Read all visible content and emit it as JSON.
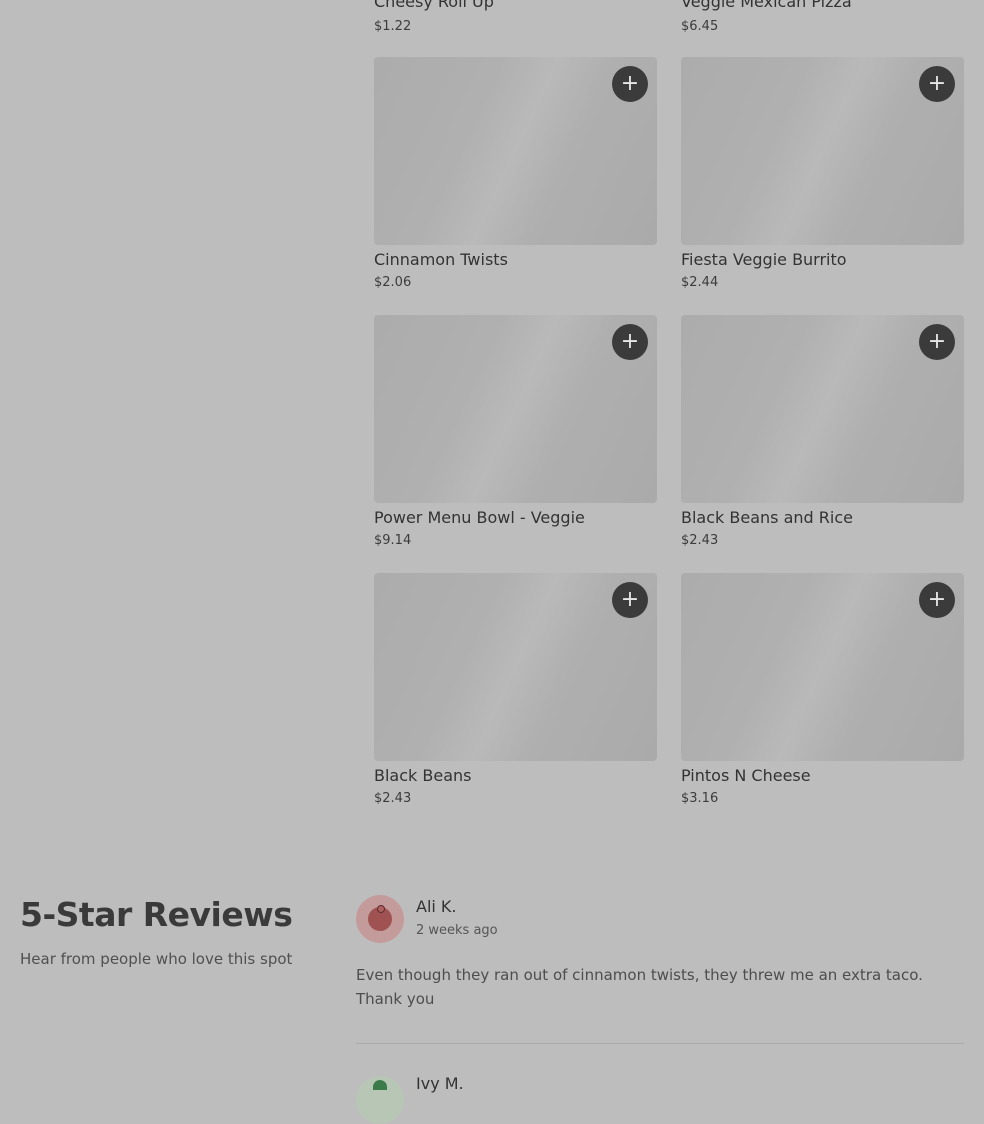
{
  "top_items": [
    {
      "name": "Cheesy Roll Up",
      "price": "$1.22"
    },
    {
      "name": "Veggie Mexican Pizza",
      "price": "$6.45"
    }
  ],
  "menu_items": [
    {
      "name": "Cinnamon Twists",
      "price": "$2.06",
      "add_icon": "+"
    },
    {
      "name": "Fiesta Veggie Burrito",
      "price": "$2.44",
      "add_icon": "+"
    },
    {
      "name": "Power Menu Bowl - Veggie",
      "price": "$9.14",
      "add_icon": "+"
    },
    {
      "name": "Black Beans and Rice",
      "price": "$2.43",
      "add_icon": "+"
    },
    {
      "name": "Black Beans",
      "price": "$2.43",
      "add_icon": "+"
    },
    {
      "name": "Pintos N Cheese",
      "price": "$3.16",
      "add_icon": "+"
    }
  ],
  "reviews_section": {
    "title": "5-Star Reviews",
    "subtitle": "Hear from people who love this spot"
  },
  "reviews": [
    {
      "name": "Ali K.",
      "time": "2 weeks ago",
      "text": "Even though they ran out of cinnamon twists, they threw me an extra taco. Thank you",
      "avatar_icon": "tomato-icon"
    },
    {
      "name": "Ivy M.",
      "avatar_icon": "leaf-icon"
    }
  ],
  "colors": {
    "overlay_bg": "#bdbdbd",
    "add_button": "#3b3b3b"
  }
}
